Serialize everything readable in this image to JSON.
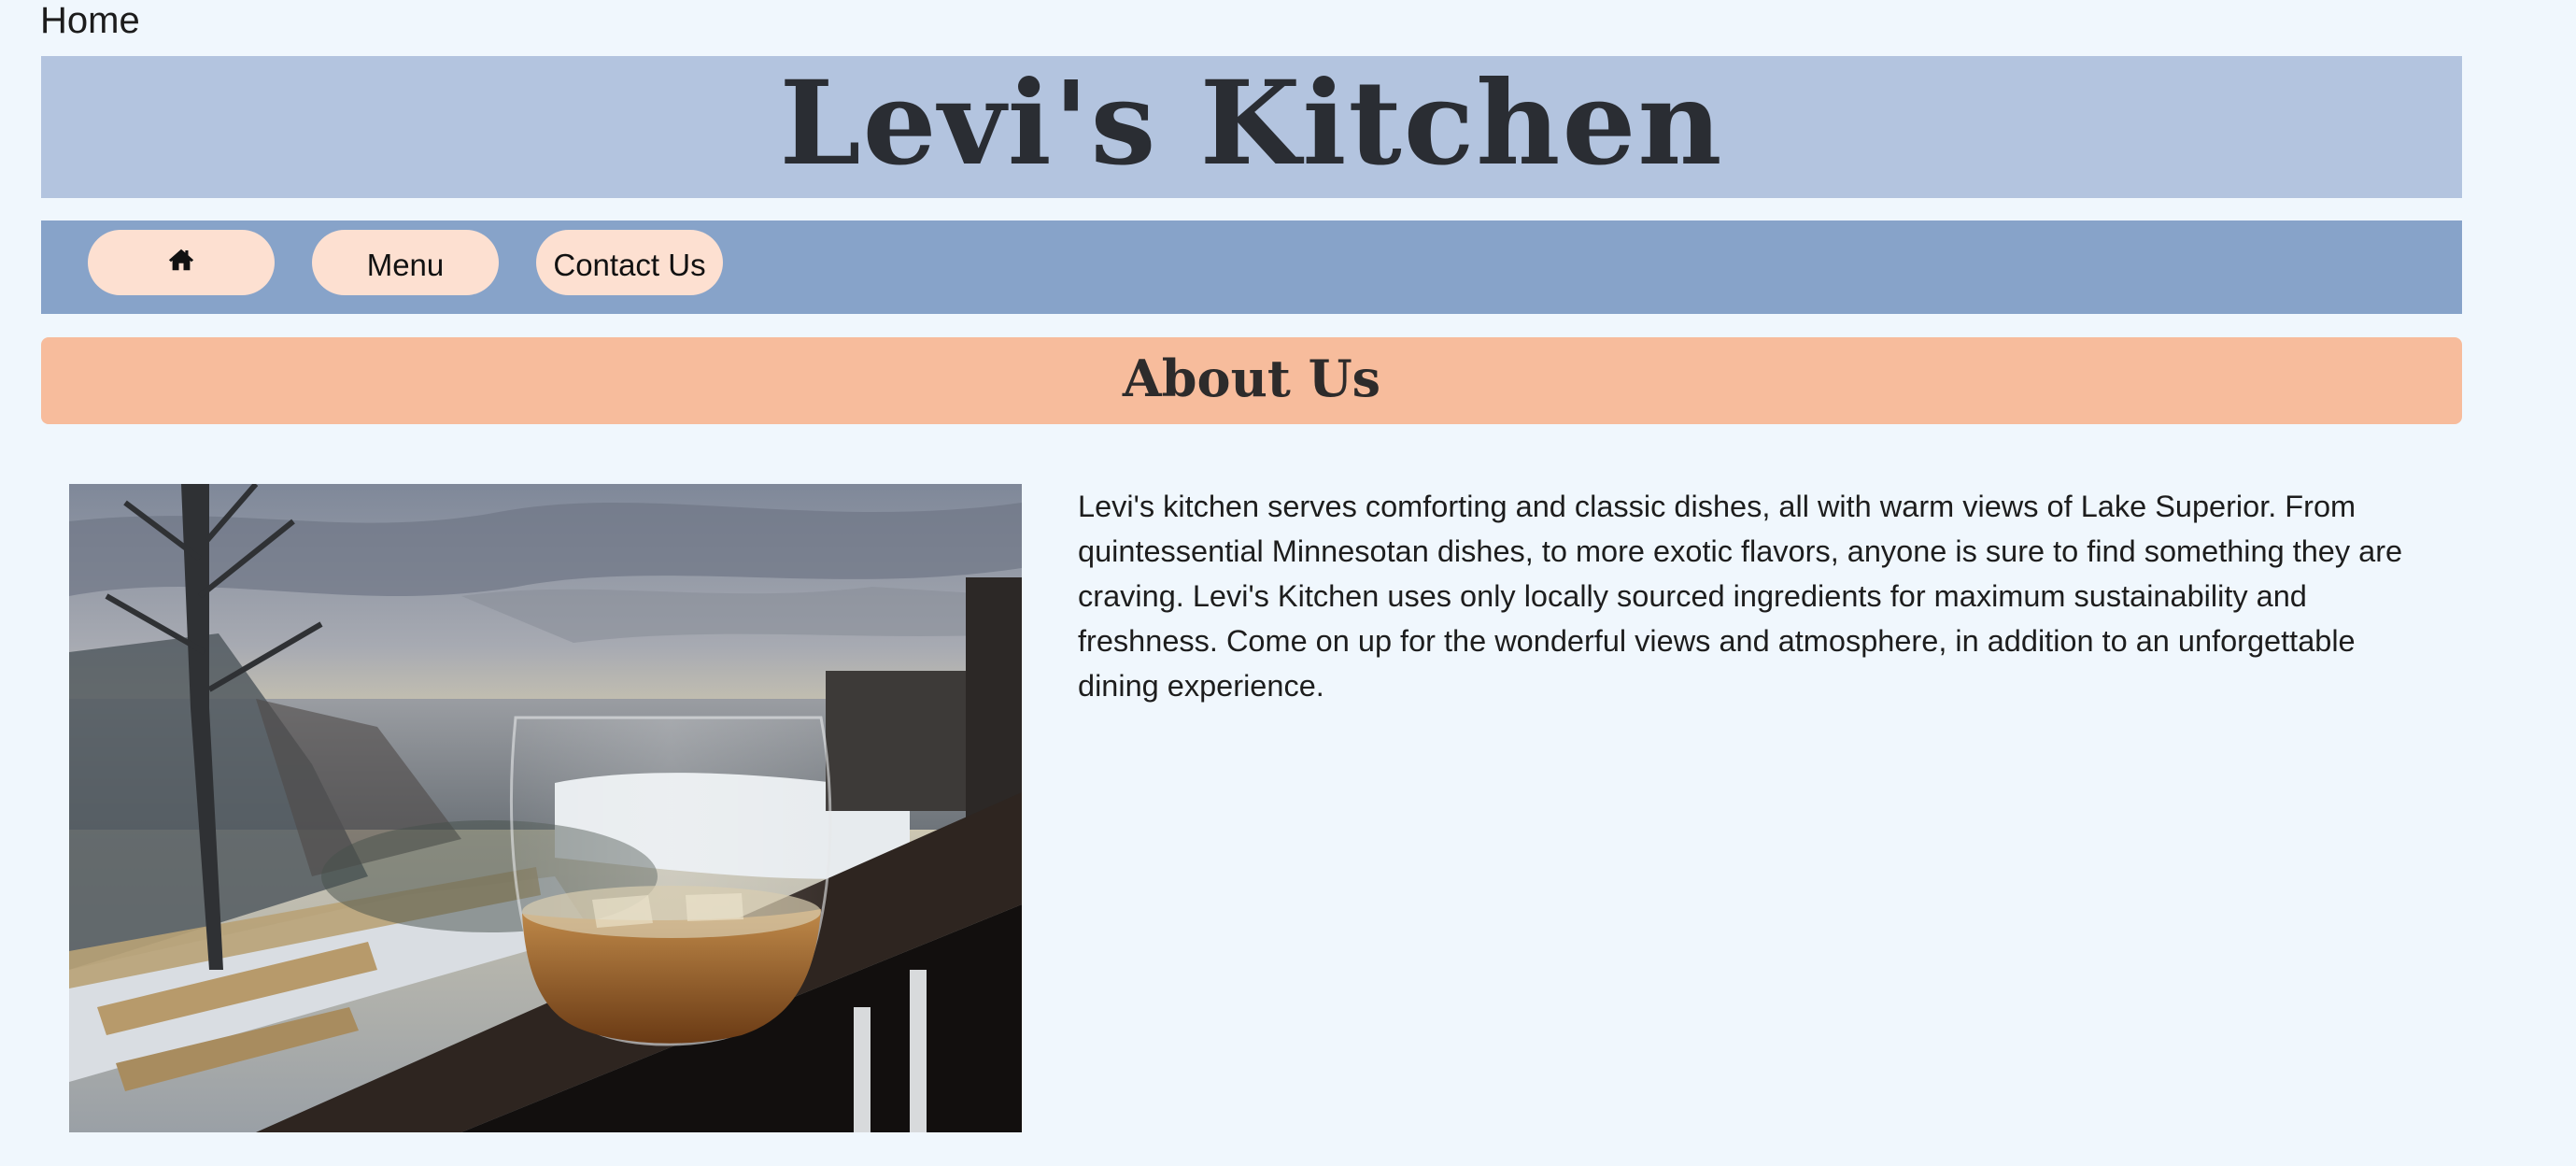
{
  "page": {
    "label": "Home"
  },
  "header": {
    "title": "Levi's Kitchen"
  },
  "nav": {
    "home_icon": "home-icon",
    "menu_label": "Menu",
    "contact_label": "Contact Us"
  },
  "section": {
    "title": "About Us"
  },
  "about": {
    "text": "Levi's kitchen serves comforting and classic dishes, all with warm views of Lake Superior. From quintessential Minnesotan dishes, to more exotic flavors, anyone is sure to find something they are craving. Levi's Kitchen uses only locally sourced ingredients for maximum sustainability and freshness. Come on up for the wonderful views and atmosphere, in addition to an unforgettable dining experience."
  },
  "colors": {
    "background": "#f0f7fd",
    "banner": "#b3c4df",
    "navbar": "#87a3c9",
    "nav_button": "#fde0d1",
    "section_bar": "#f7bc9c"
  }
}
